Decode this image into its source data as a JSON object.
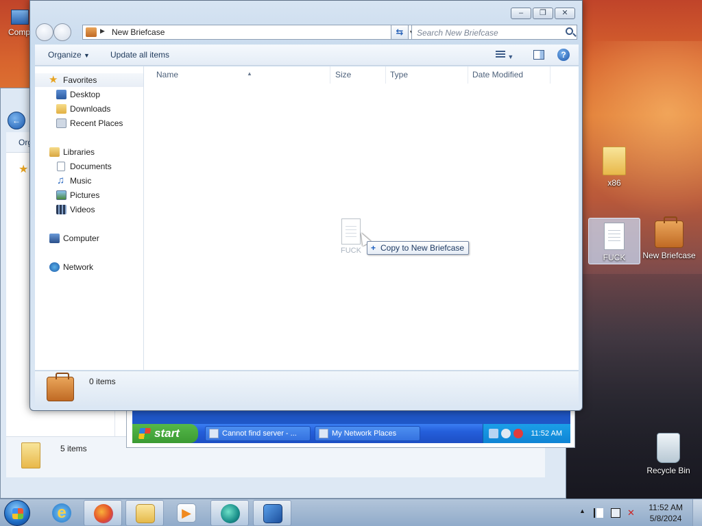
{
  "window": {
    "address": {
      "breadcrumb": "New Briefcase"
    },
    "search": {
      "placeholder": "Search New Briefcase"
    },
    "toolbar": {
      "organize": "Organize",
      "update_all": "Update all items"
    },
    "nav": {
      "favorites": "Favorites",
      "desktop": "Desktop",
      "downloads": "Downloads",
      "recent_places": "Recent Places",
      "libraries": "Libraries",
      "documents": "Documents",
      "music": "Music",
      "pictures": "Pictures",
      "videos": "Videos",
      "computer": "Computer",
      "network": "Network"
    },
    "columns": {
      "name": "Name",
      "size": "Size",
      "type": "Type",
      "date_modified": "Date Modified"
    },
    "drag": {
      "item_label": "FUCK",
      "tooltip": "Copy to New Briefcase"
    },
    "details": {
      "count": "0 items"
    }
  },
  "background_window": {
    "status_count": "5 items",
    "toolbar_partial": "Org"
  },
  "desktop": {
    "left_icon_partial": "Comp",
    "icons": {
      "x86": "x86",
      "fuck": "FUCK",
      "new_briefcase": "New Briefcase",
      "recycle_bin": "Recycle Bin"
    }
  },
  "xp_screen": {
    "start": "start",
    "tasks": [
      "Cannot find server - ...",
      "My Network Places"
    ],
    "clock": "11:52 AM"
  },
  "taskbar": {
    "time": "11:52 AM",
    "date": "5/8/2024"
  },
  "colors": {
    "accent": "#1d6cc4",
    "xp_taskbar": "#245edb",
    "xp_start": "#3b9a32"
  }
}
